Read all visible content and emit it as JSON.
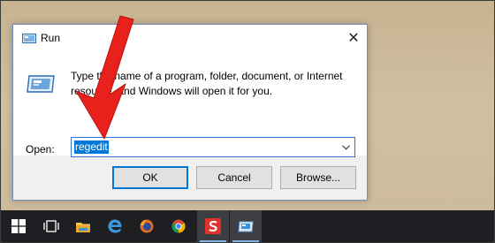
{
  "dialog": {
    "title": "Run",
    "close_glyph": "✕",
    "description": "Type the name of a program, folder, document, or Internet resource, and Windows will open it for you.",
    "open_label": "Open:",
    "open_value": "regedit",
    "buttons": {
      "ok": "OK",
      "cancel": "Cancel",
      "browse": "Browse..."
    }
  },
  "taskbar": {
    "items": [
      {
        "icon": "windows-start-icon"
      },
      {
        "icon": "task-view-icon"
      },
      {
        "icon": "file-explorer-icon"
      },
      {
        "icon": "edge-icon"
      },
      {
        "icon": "firefox-icon"
      },
      {
        "icon": "chrome-icon"
      },
      {
        "icon": "snagit-icon",
        "active": true
      },
      {
        "icon": "run-icon",
        "active": true
      }
    ]
  },
  "colors": {
    "accent": "#0078d7",
    "annotation_arrow": "#e8211d",
    "taskbar": "#1e1f22",
    "desktop": "#cbb99a"
  }
}
